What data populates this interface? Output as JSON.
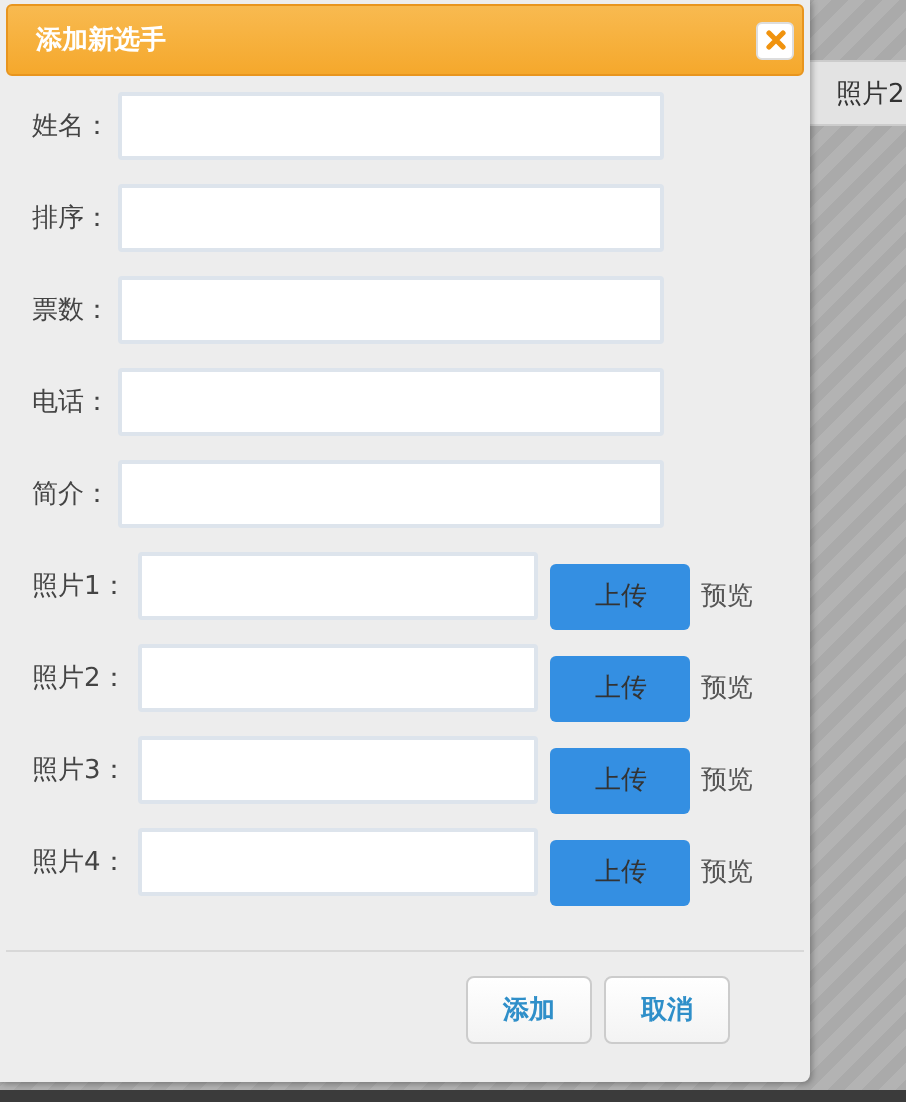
{
  "background": {
    "column_header": "照片2"
  },
  "dialog": {
    "title": "添加新选手",
    "fields": [
      {
        "kind": "text",
        "label": "姓名："
      },
      {
        "kind": "text",
        "label": "排序："
      },
      {
        "kind": "text",
        "label": "票数："
      },
      {
        "kind": "text",
        "label": "电话："
      },
      {
        "kind": "text",
        "label": "简介："
      },
      {
        "kind": "photo",
        "label": "照片1：",
        "upload": "上传",
        "preview": "预览"
      },
      {
        "kind": "photo",
        "label": "照片2：",
        "upload": "上传",
        "preview": "预览"
      },
      {
        "kind": "photo",
        "label": "照片3：",
        "upload": "上传",
        "preview": "预览"
      },
      {
        "kind": "photo",
        "label": "照片4：",
        "upload": "上传",
        "preview": "预览"
      }
    ],
    "buttons": [
      "添加",
      "取消"
    ]
  }
}
